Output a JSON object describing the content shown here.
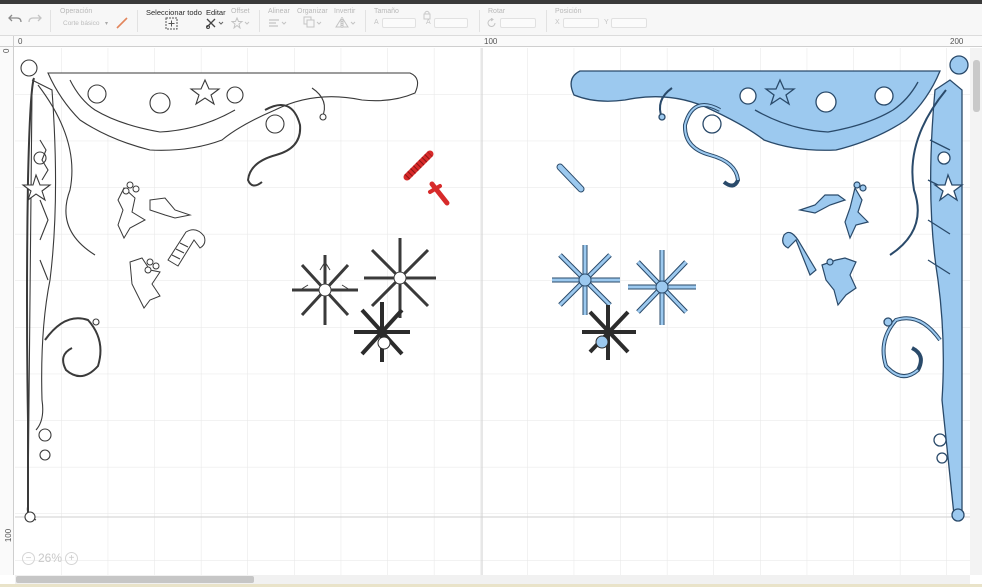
{
  "toolbar": {
    "undo_icon": "undo-icon",
    "redo_icon": "redo-icon",
    "operacion": {
      "label": "Operación",
      "value": "Corte básico"
    },
    "seleccionar_todo": {
      "label": "Seleccionar todo"
    },
    "editar": {
      "label": "Editar"
    },
    "offset": {
      "label": "Offset"
    },
    "alinear": {
      "label": "Alinear"
    },
    "organizar": {
      "label": "Organizar"
    },
    "invertir": {
      "label": "Invertir"
    },
    "tamano": {
      "label": "Tamaño",
      "w_label": "A",
      "h_label": "A"
    },
    "rotar": {
      "label": "Rotar"
    },
    "posicion": {
      "label": "Posición",
      "x_label": "X",
      "y_label": "Y"
    }
  },
  "rulers": {
    "top": [
      "0",
      "100",
      "200"
    ],
    "left": [
      "0",
      "100"
    ]
  },
  "zoom": {
    "value": "26%",
    "minus": "−",
    "plus": "+"
  },
  "colors": {
    "grid": "#e4e4e4",
    "major_grid": "#cfcfcf",
    "outline": "#3a3a3a",
    "blue_fill": "#9cc9ef",
    "blue_stroke": "#2a4a6a",
    "red": "#d72a2a",
    "dark_snow": "#2c2c2c"
  }
}
